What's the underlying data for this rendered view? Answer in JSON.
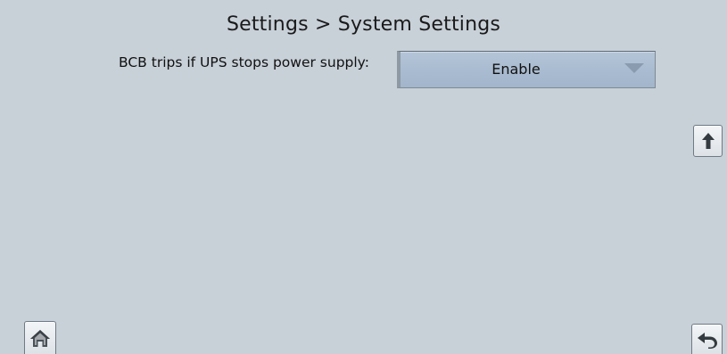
{
  "header": {
    "title": "Settings > System Settings"
  },
  "settings": {
    "items": [
      {
        "label": "BCB trips if UPS stops power supply:",
        "value": "Enable"
      }
    ]
  },
  "icons": {
    "scroll_up": "arrow-up-icon",
    "home": "home-icon",
    "back": "back-arrow-icon",
    "dropdown": "chevron-down-icon"
  },
  "colors": {
    "background": "#c8d0d8",
    "dropdown_fill": "#a9bbd0",
    "button_fill": "#e8ecf0"
  }
}
